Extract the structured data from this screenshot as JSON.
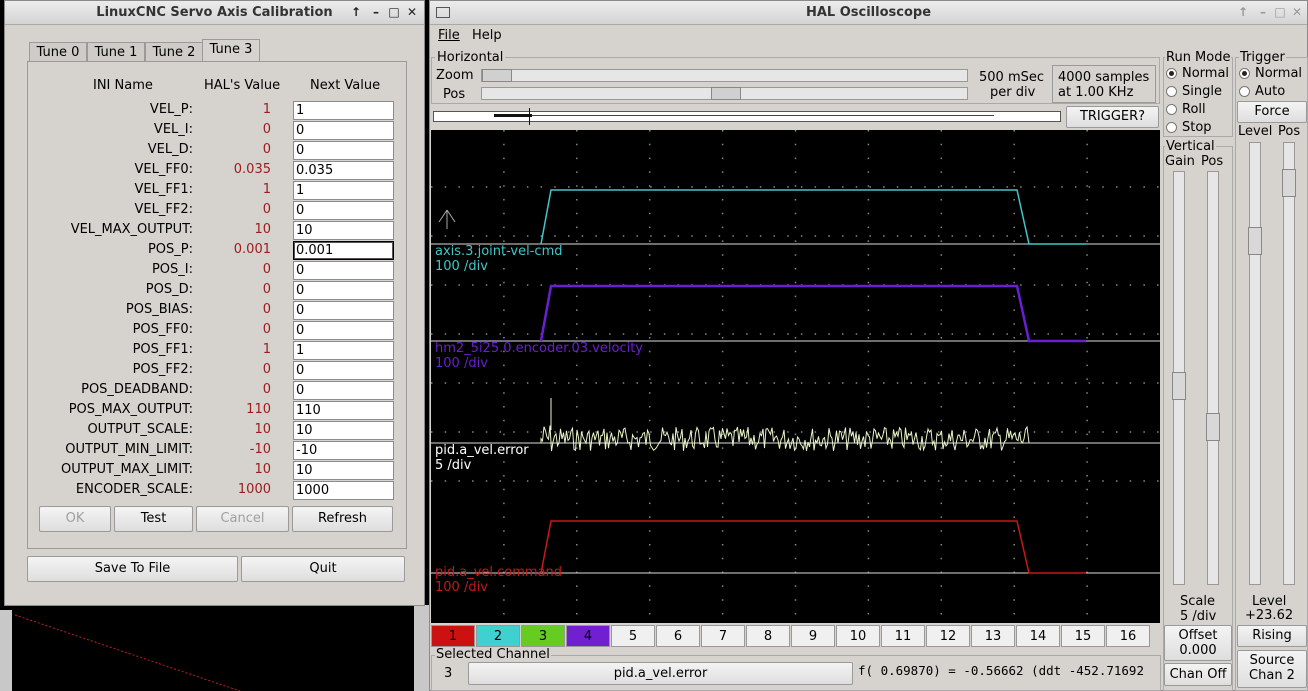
{
  "calib": {
    "title": "LinuxCNC Servo Axis Calibration",
    "tabs": [
      "Tune 0",
      "Tune 1",
      "Tune 2",
      "Tune 3"
    ],
    "headers": {
      "ini": "INI Name",
      "hal": "HAL's Value",
      "next": "Next Value"
    },
    "rows": [
      {
        "name": "VEL_P:",
        "hal": "1",
        "next": "1"
      },
      {
        "name": "VEL_I:",
        "hal": "0",
        "next": "0"
      },
      {
        "name": "VEL_D:",
        "hal": "0",
        "next": "0"
      },
      {
        "name": "VEL_FF0:",
        "hal": "0.035",
        "next": "0.035"
      },
      {
        "name": "VEL_FF1:",
        "hal": "1",
        "next": "1"
      },
      {
        "name": "VEL_FF2:",
        "hal": "0",
        "next": "0"
      },
      {
        "name": "VEL_MAX_OUTPUT:",
        "hal": "10",
        "next": "10"
      },
      {
        "name": "POS_P:",
        "hal": "0.001",
        "next": "0.001"
      },
      {
        "name": "POS_I:",
        "hal": "0",
        "next": "0"
      },
      {
        "name": "POS_D:",
        "hal": "0",
        "next": "0"
      },
      {
        "name": "POS_BIAS:",
        "hal": "0",
        "next": "0"
      },
      {
        "name": "POS_FF0:",
        "hal": "0",
        "next": "0"
      },
      {
        "name": "POS_FF1:",
        "hal": "1",
        "next": "1"
      },
      {
        "name": "POS_FF2:",
        "hal": "0",
        "next": "0"
      },
      {
        "name": "POS_DEADBAND:",
        "hal": "0",
        "next": "0"
      },
      {
        "name": "POS_MAX_OUTPUT:",
        "hal": "110",
        "next": "110"
      },
      {
        "name": "OUTPUT_SCALE:",
        "hal": "10",
        "next": "10"
      },
      {
        "name": "OUTPUT_MIN_LIMIT:",
        "hal": "-10",
        "next": "-10"
      },
      {
        "name": "OUTPUT_MAX_LIMIT:",
        "hal": "10",
        "next": "10"
      },
      {
        "name": "ENCODER_SCALE:",
        "hal": "1000",
        "next": "1000"
      }
    ],
    "buttons": {
      "ok": "OK",
      "test": "Test",
      "cancel": "Cancel",
      "refresh": "Refresh",
      "save": "Save To File",
      "quit": "Quit"
    }
  },
  "scope": {
    "title": "HAL Oscilloscope",
    "menu": {
      "file": "File",
      "help": "Help"
    },
    "horizontal": {
      "label": "Horizontal",
      "zoom": "Zoom",
      "pos": "Pos",
      "rate_line1": "500 mSec",
      "rate_line2": "per div",
      "samples_line1": "4000 samples",
      "samples_line2": "at 1.00 KHz",
      "trigger_btn": "TRIGGER?"
    },
    "run_mode": {
      "label": "Run Mode",
      "options": [
        "Normal",
        "Single",
        "Roll",
        "Stop"
      ],
      "selected": "Normal"
    },
    "trigger": {
      "label": "Trigger",
      "options": [
        "Normal",
        "Auto"
      ],
      "selected": "Normal",
      "force": "Force",
      "level_label": "Level",
      "pos_label": "Pos",
      "level_title": "Level",
      "level_value": "+23.62",
      "edge": "Rising",
      "source_line1": "Source",
      "source_line2": "Chan  2"
    },
    "vertical": {
      "label": "Vertical",
      "gain": "Gain",
      "pos": "Pos",
      "scale_label": "Scale",
      "scale_value": "5 /div",
      "offset_label": "Offset",
      "offset_value": "0.000",
      "chan_off": "Chan Off"
    },
    "traces": [
      {
        "name": "axis.3.joint-vel-cmd",
        "scale": "100 /div",
        "color": "#3fc7c7"
      },
      {
        "name": "hm2_5i25.0.encoder.03.velocity",
        "scale": "100 /div",
        "color": "#6a1fd0"
      },
      {
        "name": "pid.a_vel.error",
        "scale": "5 /div",
        "color": "#ffffff"
      },
      {
        "name": "pid.a_vel.command",
        "scale": "100 /div",
        "color": "#c81818"
      }
    ],
    "channels": [
      "1",
      "2",
      "3",
      "4",
      "5",
      "6",
      "7",
      "8",
      "9",
      "10",
      "11",
      "12",
      "13",
      "14",
      "15",
      "16"
    ],
    "channel_colors": [
      "#cc1111",
      "#3fd0d0",
      "#66cc22",
      "#7020d0"
    ],
    "selected": {
      "label": "Selected Channel",
      "number": "3",
      "name": "pid.a_vel.error",
      "readout": "f( 0.69870) = -0.56662 (ddt -452.71692"
    }
  }
}
